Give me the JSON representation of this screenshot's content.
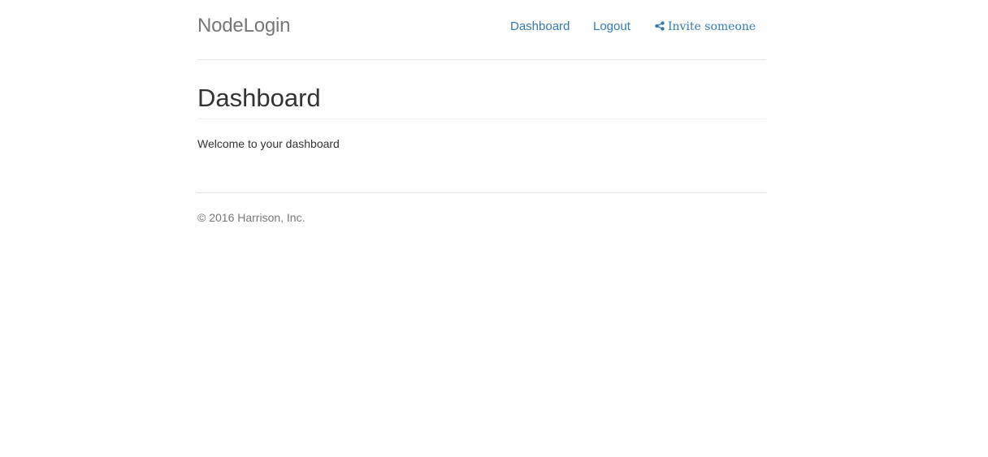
{
  "header": {
    "brand": "NodeLogin",
    "nav": [
      {
        "label": "Dashboard"
      },
      {
        "label": "Logout"
      },
      {
        "label": "Invite someone",
        "icon": "share-icon"
      }
    ]
  },
  "main": {
    "title": "Dashboard",
    "welcome": "Welcome to your dashboard"
  },
  "footer": {
    "text": "© 2016 Harrison, Inc."
  },
  "colors": {
    "link": "#337ab7",
    "muted": "#777777",
    "text": "#333333"
  }
}
